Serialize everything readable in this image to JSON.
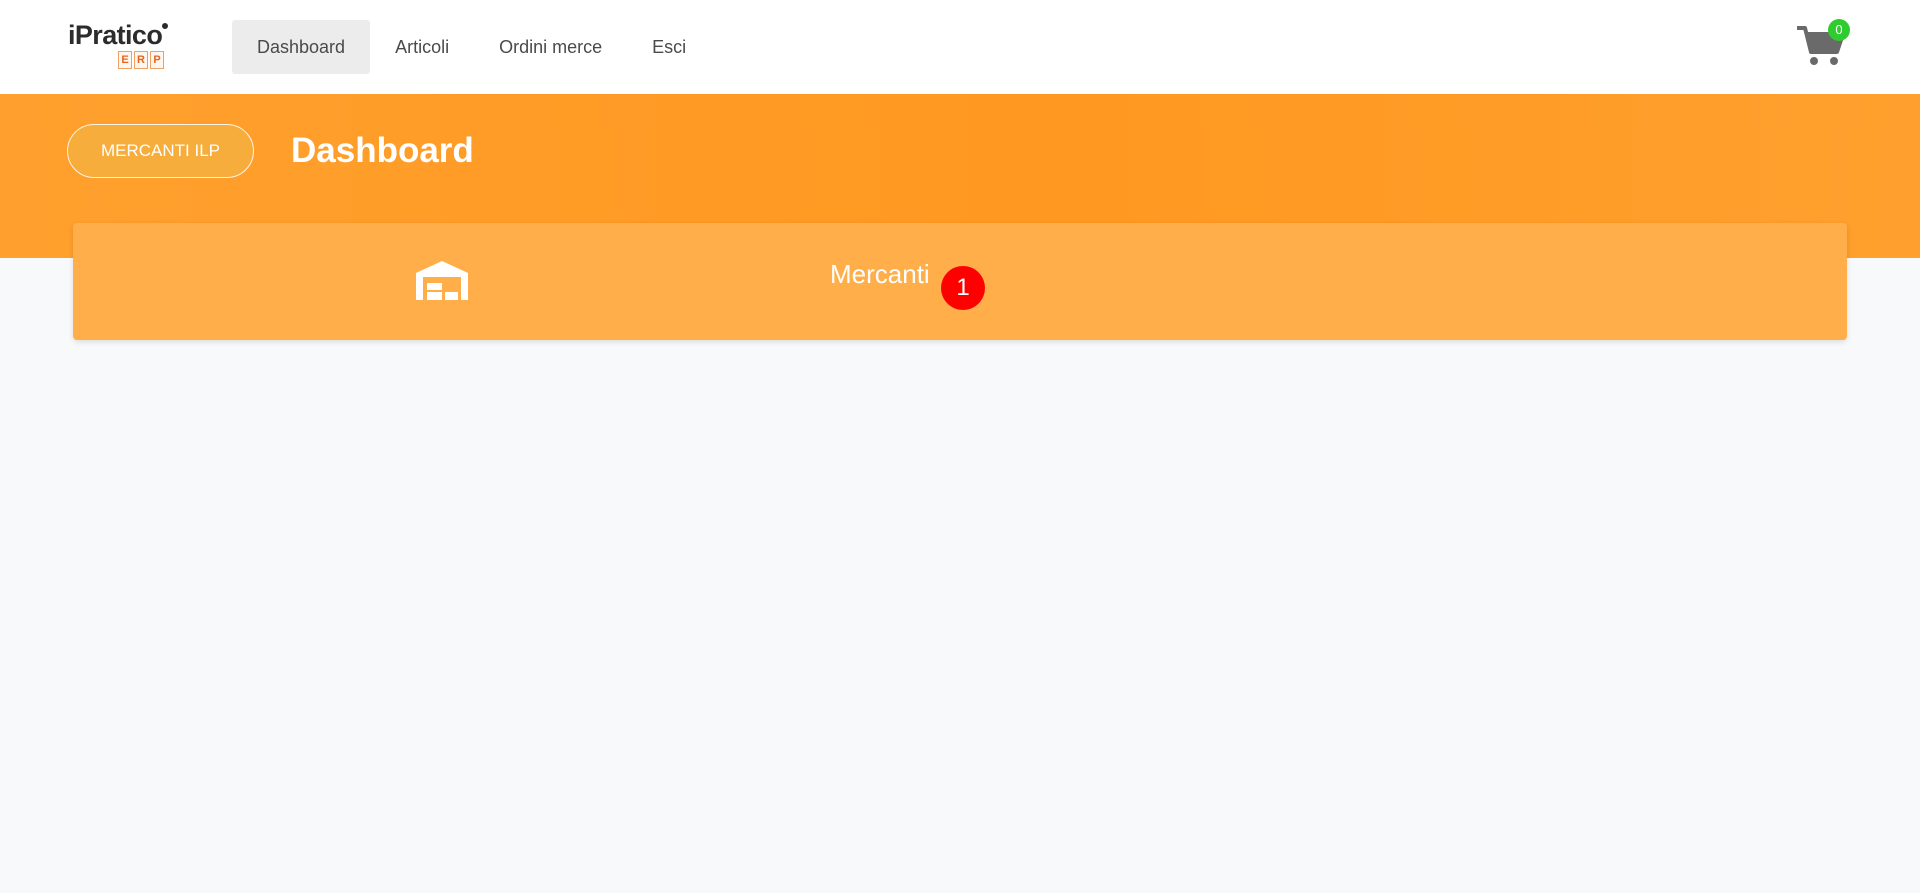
{
  "brand": {
    "name": "iPratico",
    "erp_letters": [
      "E",
      "R",
      "P"
    ]
  },
  "nav": {
    "items": [
      {
        "label": "Dashboard",
        "active": true
      },
      {
        "label": "Articoli",
        "active": false
      },
      {
        "label": "Ordini merce",
        "active": false
      },
      {
        "label": "Esci",
        "active": false
      }
    ]
  },
  "cart": {
    "icon": "shopping-cart-icon",
    "count": "0",
    "count_color": "#2fcc2f"
  },
  "header": {
    "merchant_button": "MERCANTI ILP",
    "title": "Dashboard"
  },
  "dashboard": {
    "tiles": [
      {
        "icon": "warehouse-icon",
        "label": "Mercanti",
        "badge": "1",
        "badge_color": "#ff0000"
      }
    ]
  },
  "theme": {
    "accent": "#ff9f2b",
    "tile": "#ffae4a",
    "background": "#f8f9fb"
  }
}
